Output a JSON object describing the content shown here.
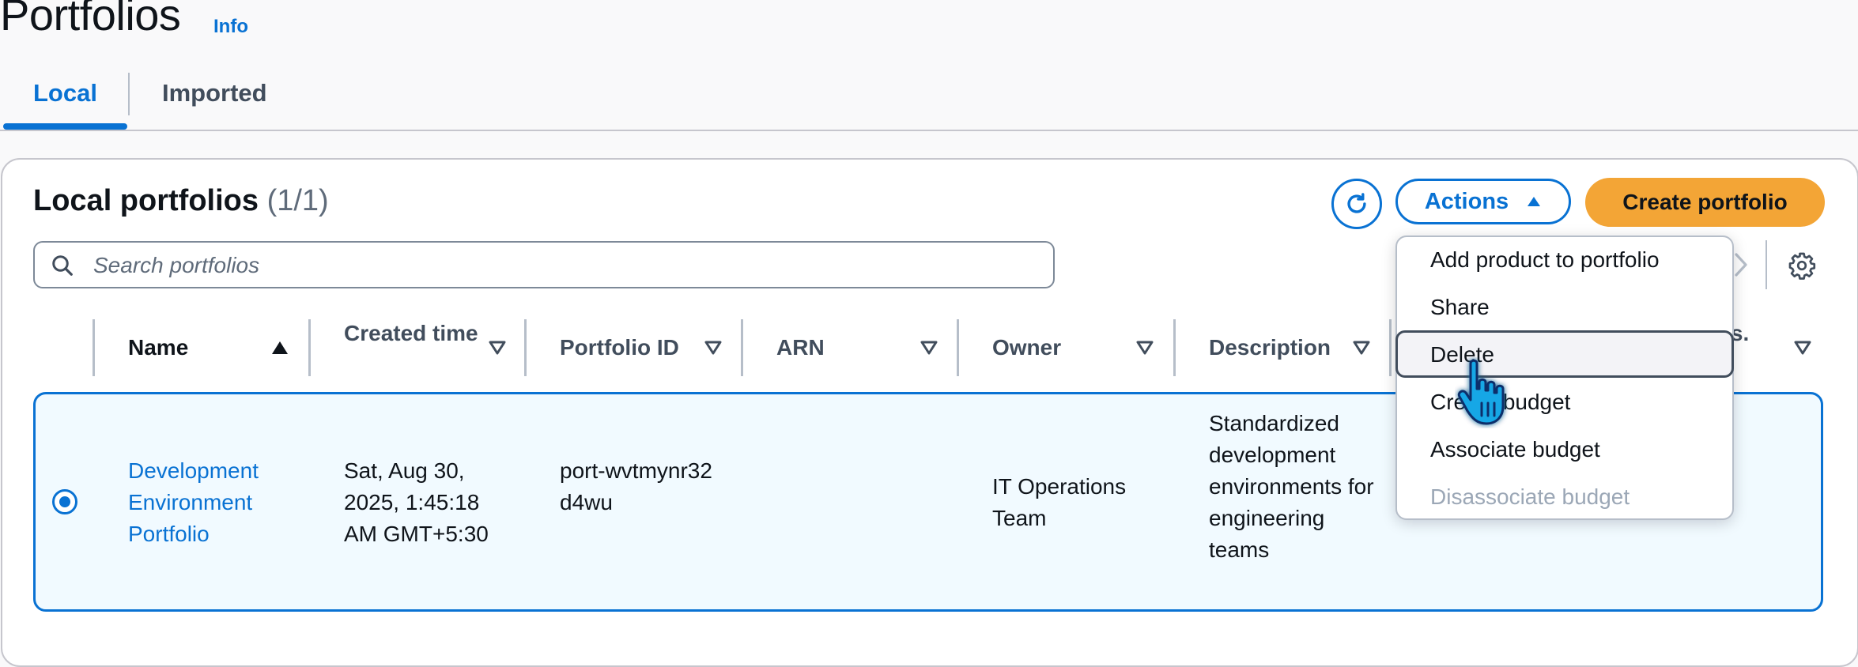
{
  "page": {
    "title": "Portfolios",
    "info_link": "Info"
  },
  "tabs": [
    {
      "label": "Local",
      "active": true
    },
    {
      "label": "Imported",
      "active": false
    }
  ],
  "panel": {
    "title": "Local portfolios",
    "count": "(1/1)",
    "actions_label": "Actions",
    "create_label": "Create portfolio",
    "search_placeholder": "Search portfolios"
  },
  "table": {
    "columns": [
      {
        "label": "Name",
        "sort": "ascending"
      },
      {
        "label": "Created time",
        "sort": "none"
      },
      {
        "label": "Portfolio ID",
        "sort": "none"
      },
      {
        "label": "ARN",
        "sort": "none"
      },
      {
        "label": "Owner",
        "sort": "none"
      },
      {
        "label": "Description",
        "sort": "none"
      },
      {
        "label": "...vs.",
        "sort": "none"
      }
    ],
    "rows": [
      {
        "selected": true,
        "name": "Development Environment Portfolio",
        "created_time": "Sat, Aug 30, 2025, 1:45:18 AM GMT+5:30",
        "portfolio_id": "port-wvtmynr32d4wu",
        "arn": "",
        "owner": "IT Operations Team",
        "description": "Standardized development environments for engineering teams"
      }
    ]
  },
  "actions_menu": {
    "items": [
      {
        "label": "Add product to portfolio",
        "enabled": true
      },
      {
        "label": "Share",
        "enabled": true
      },
      {
        "label": "Delete",
        "enabled": true,
        "hovered": true
      },
      {
        "label": "Create budget",
        "enabled": true
      },
      {
        "label": "Associate budget",
        "enabled": true
      },
      {
        "label": "Disassociate budget",
        "enabled": false
      }
    ]
  },
  "colors": {
    "accent": "#0972d3",
    "primary_button": "#f3a536",
    "selected_row_bg": "#f1faff",
    "text": "#0f141a",
    "muted_text": "#5f6b7a"
  },
  "icons": [
    "refresh-icon",
    "caret-up-icon",
    "search-icon",
    "chevron-right-icon",
    "settings-icon",
    "sort-ascending-icon",
    "sort-descending-icon",
    "hand-cursor-icon"
  ]
}
